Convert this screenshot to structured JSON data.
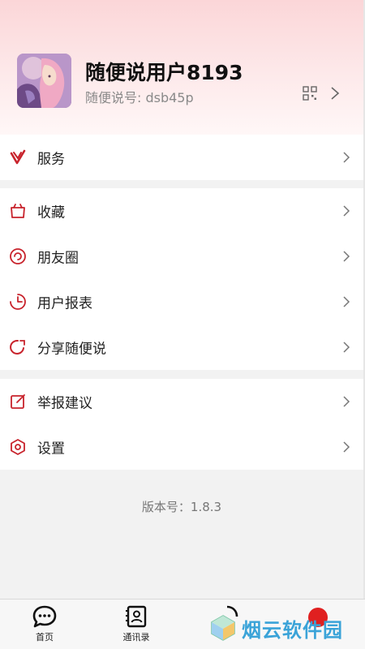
{
  "profile": {
    "username": "随便说用户8193",
    "account_label": "随便说号: dsb45p"
  },
  "menu": {
    "section1": [
      {
        "label": "服务",
        "icon": "service-icon"
      }
    ],
    "section2": [
      {
        "label": "收藏",
        "icon": "favorites-icon"
      },
      {
        "label": "朋友圈",
        "icon": "moments-icon"
      },
      {
        "label": "用户报表",
        "icon": "report-icon"
      },
      {
        "label": "分享随便说",
        "icon": "share-icon"
      }
    ],
    "section3": [
      {
        "label": "举报建议",
        "icon": "feedback-icon"
      },
      {
        "label": "设置",
        "icon": "settings-icon"
      }
    ]
  },
  "version_text": "版本号：1.8.3",
  "tabbar": {
    "tabs": [
      {
        "label": "首页",
        "icon": "chat-bubble-icon"
      },
      {
        "label": "通讯录",
        "icon": "contacts-icon"
      }
    ]
  },
  "watermark": {
    "text": "烟云软件园"
  },
  "colors": {
    "accent_red": "#c8232c",
    "header_gradient_top": "#fbd6d8",
    "watermark_blue": "#3aa3d8"
  }
}
